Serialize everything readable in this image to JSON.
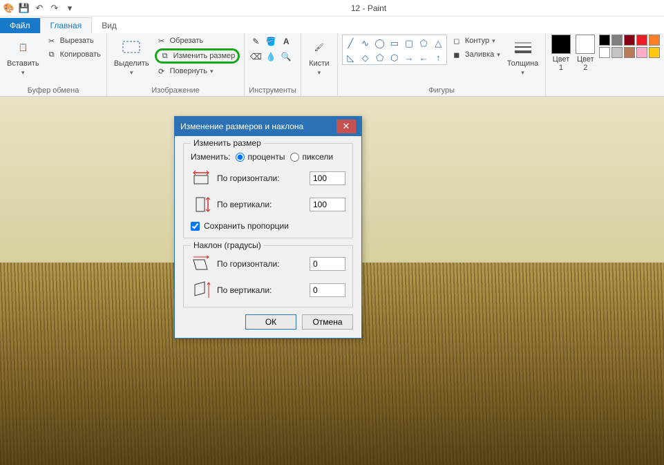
{
  "window": {
    "title": "12 - Paint"
  },
  "tabs": {
    "file": "Файл",
    "home": "Главная",
    "view": "Вид"
  },
  "ribbon": {
    "clipboard": {
      "paste": "Вставить",
      "cut": "Вырезать",
      "copy": "Копировать",
      "group": "Буфер обмена"
    },
    "image": {
      "select": "Выделить",
      "crop": "Обрезать",
      "resize": "Изменить размер",
      "rotate": "Повернуть",
      "group": "Изображение"
    },
    "tools": {
      "group": "Инструменты"
    },
    "brushes": {
      "label": "Кисти"
    },
    "shapes": {
      "outline": "Контур",
      "fill": "Заливка",
      "group": "Фигуры",
      "thickness": "Толщина",
      "items": [
        "╱",
        "◇",
        "◯",
        "▭",
        "△",
        "→",
        "─",
        "◇",
        "○",
        "□",
        "△",
        "↔",
        "↑",
        "↓",
        "☆",
        "☆",
        "☆",
        "⬠",
        "⬠",
        "✧",
        "⬭"
      ]
    },
    "colors": {
      "c1": "Цвет 1",
      "c2": "Цвет 2",
      "c1_hex": "#000000",
      "c2_hex": "#ffffff",
      "palette": [
        "#000000",
        "#7f7f7f",
        "#880015",
        "#ed1c24",
        "#ff7f27",
        "#ffffff",
        "#c3c3c3",
        "#b97a57",
        "#ffaec9",
        "#ffc90e"
      ]
    }
  },
  "dialog": {
    "title": "Изменение размеров и наклона",
    "resize": {
      "legend": "Изменить размер",
      "by_label": "Изменить:",
      "percent": "проценты",
      "pixels": "пиксели",
      "horiz": "По горизонтали:",
      "vert": "По вертикали:",
      "h_val": "100",
      "v_val": "100",
      "keep_aspect": "Сохранить пропорции"
    },
    "skew": {
      "legend": "Наклон (градусы)",
      "horiz": "По горизонтали:",
      "vert": "По вертикали:",
      "h_val": "0",
      "v_val": "0"
    },
    "ok": "ОК",
    "cancel": "Отмена"
  }
}
